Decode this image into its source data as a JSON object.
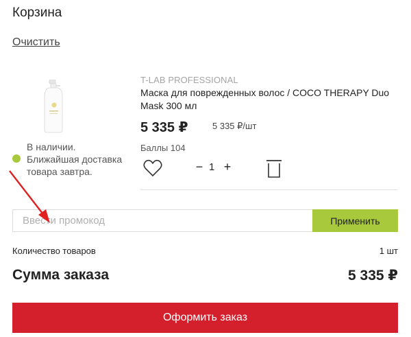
{
  "cart": {
    "title": "Корзина",
    "clear_label": "Очистить"
  },
  "item": {
    "brand": "T-LAB PROFESSIONAL",
    "name": "Маска для поврежденных волос / COCO THERAPY Duo Mask 300 мл",
    "price": "5 335 ₽",
    "unit_price": "5 335 ₽/шт",
    "points": "Баллы 104",
    "quantity": "1",
    "minus_label": "−",
    "plus_label": "+",
    "stock_text": "В наличии.\nБлижайшая доставка\nтовара завтра.",
    "stock_color": "#a7c93b",
    "image_icon": "product-bottle-icon",
    "favorite_icon": "heart-icon",
    "delete_icon": "trash-icon"
  },
  "promo": {
    "placeholder": "Ввести промокод",
    "apply_label": "Применить",
    "apply_color": "#a7c93b"
  },
  "summary": {
    "count_label": "Количество товаров",
    "count_value": "1 шт",
    "total_label": "Сумма заказа",
    "total_value": "5 335 ₽"
  },
  "checkout": {
    "label": "Оформить заказ",
    "color": "#d41f2c"
  },
  "annotation": {
    "arrow_color": "#e02020"
  }
}
